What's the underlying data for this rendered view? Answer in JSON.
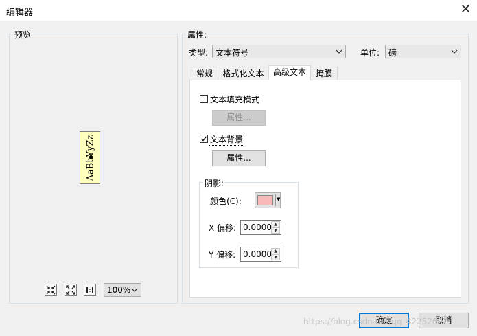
{
  "window": {
    "title": "编辑器"
  },
  "preview": {
    "label": "预览",
    "sample_text": "AaBbYyZz",
    "zoom": "100%",
    "tools": [
      "fit-extent-icon",
      "full-extent-icon",
      "actual-size-icon"
    ]
  },
  "properties": {
    "label": "属性:",
    "type_label": "类型:",
    "type_value": "文本符号",
    "unit_label": "单位:",
    "unit_value": "磅",
    "tabs": [
      "常规",
      "格式化文本",
      "高级文本",
      "掩膜"
    ],
    "active_tab": "高级文本"
  },
  "advanced": {
    "fill_pattern": {
      "label": "文本填充模式",
      "checked": false,
      "button": "属性..."
    },
    "background": {
      "label": "文本背景",
      "checked": true,
      "button": "属性..."
    },
    "shadow": {
      "label": "阴影:",
      "color_label": "颜色(C):",
      "color": "#f8b9b9",
      "x_label": "X 偏移:",
      "x_value": "0.0000",
      "y_label": "Y 偏移:",
      "y_value": "0.0000"
    }
  },
  "footer": {
    "ok": "确定",
    "cancel": "取消"
  },
  "watermark": "https://blog.csdn.net/qq_42252697"
}
